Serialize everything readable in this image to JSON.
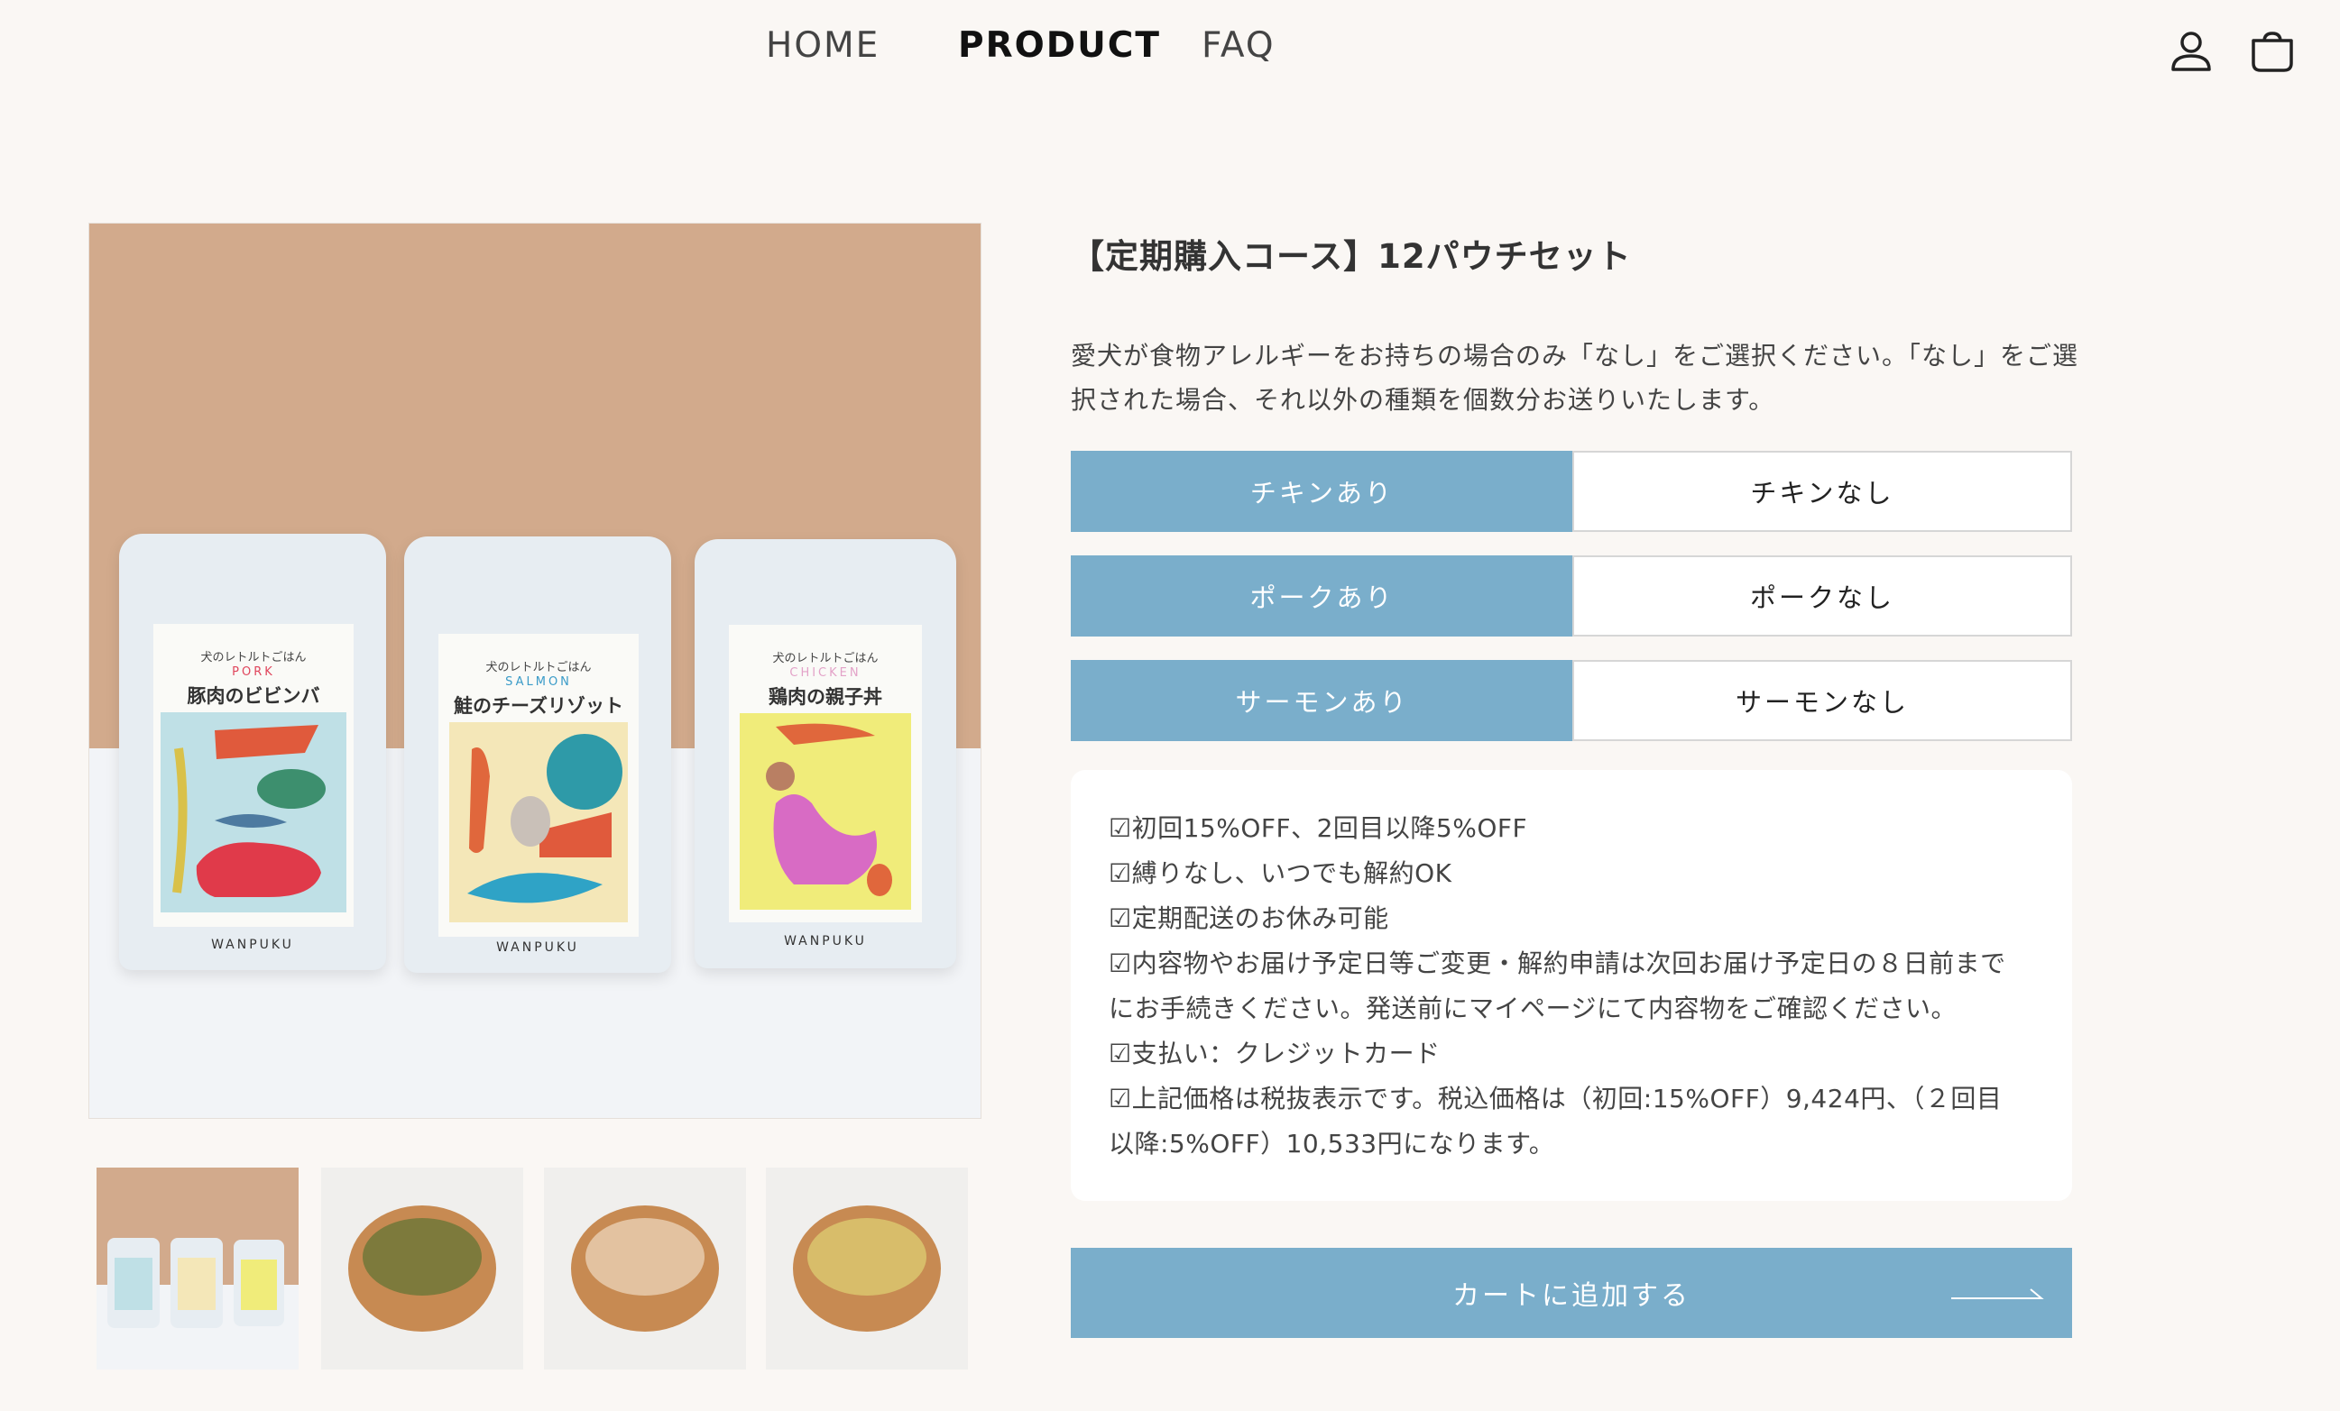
{
  "nav": {
    "home": "HOME",
    "product": "PRODUCT",
    "faq": "FAQ"
  },
  "header_icons": [
    "user-icon",
    "cart-icon"
  ],
  "product": {
    "title": "【定期購入コース】12パウチセット",
    "description": "愛犬が食物アレルギーをお持ちの場合のみ「なし」をご選択ください。「なし」をご選択された場合、それ以外の種類を個数分お送りいたします。",
    "options": [
      {
        "on": "チキンあり",
        "off": "チキンなし",
        "selected": "on"
      },
      {
        "on": "ポークあり",
        "off": "ポークなし",
        "selected": "on"
      },
      {
        "on": "サーモンあり",
        "off": "サーモンなし",
        "selected": "on"
      }
    ],
    "info_lines": [
      "☑初回15%OFF、2回目以降5%OFF",
      "☑縛りなし、いつでも解約OK",
      "☑定期配送のお休み可能",
      "☑内容物やお届け予定日等ご変更・解約申請は次回お届け予定日の８日前まで",
      "にお手続きください。発送前にマイページにて内容物をご確認ください。",
      "☑支払い：クレジットカード",
      "☑上記価格は税抜表示です。税込価格は（初回:15%OFF）9,424円、（２回目",
      "以降:5%OFF）10,533円になります。"
    ],
    "add_to_cart": "カートに追加する"
  },
  "gallery": {
    "pouches": [
      {
        "small": "犬のレトルトごはん",
        "type": "PORK",
        "name": "豚肉のビビンバ",
        "brand": "WANPUKU"
      },
      {
        "small": "犬のレトルトごはん",
        "type": "SALMON",
        "name": "鮭のチーズリゾット",
        "brand": "WANPUKU"
      },
      {
        "small": "犬のレトルトごはん",
        "type": "CHICKEN",
        "name": "鶏肉の親子丼",
        "brand": "WANPUKU"
      }
    ],
    "colors": {
      "accent": "#7aaecb",
      "background": "#faf7f4",
      "image_backdrop": "#d2aa8c"
    },
    "selected_thumbnail": 1
  }
}
